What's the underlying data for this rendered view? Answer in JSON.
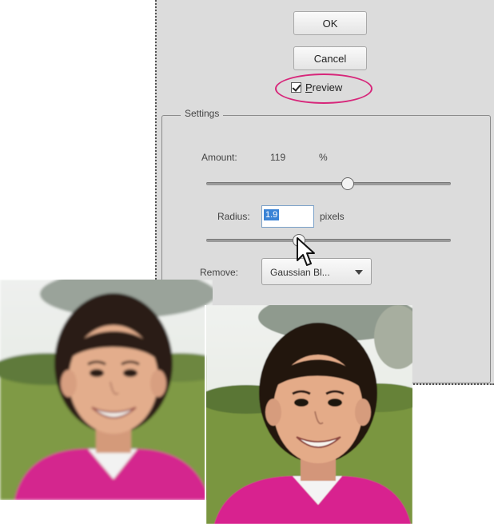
{
  "dialog": {
    "ok_label": "OK",
    "cancel_label": "Cancel",
    "preview": {
      "label": "Preview",
      "checked": true,
      "highlight_color": "#d7267a"
    },
    "settings": {
      "legend": "Settings",
      "amount": {
        "label": "Amount:",
        "value": "119",
        "unit": "%",
        "slider_fraction": 0.58
      },
      "radius": {
        "label": "Radius:",
        "value": "1.9",
        "unit": "pixels",
        "slider_fraction": 0.38
      },
      "remove": {
        "label": "Remove:",
        "selected": "Gaussian Bl..."
      }
    }
  },
  "icons": {
    "cursor": "arrow-cursor-icon",
    "dropdown": "chevron-down-icon"
  },
  "photos": {
    "left": {
      "description_id": "before"
    },
    "right": {
      "description_id": "after"
    }
  }
}
